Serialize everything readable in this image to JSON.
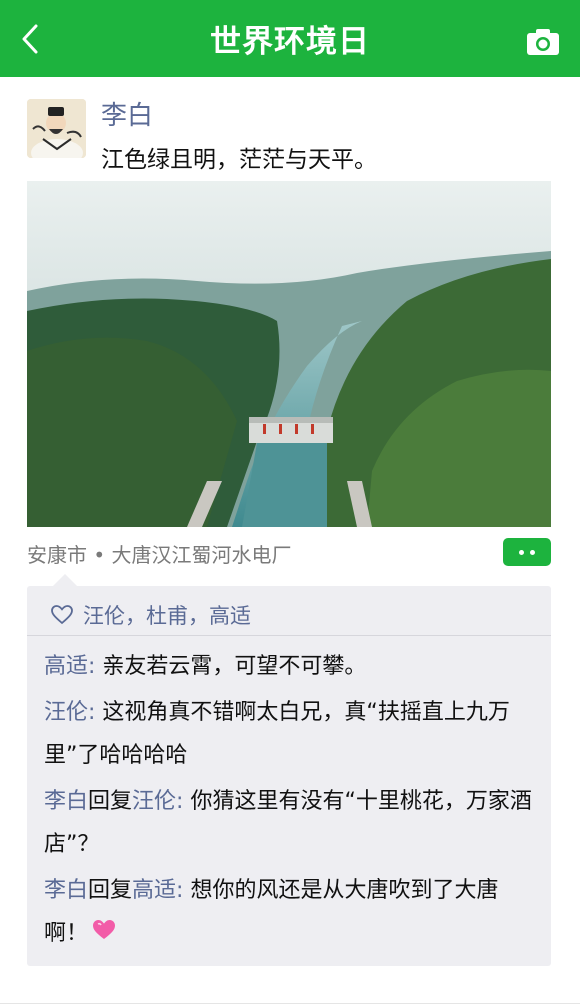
{
  "header": {
    "title": "世界环境日",
    "back_icon": "chevron-left-icon",
    "camera_icon": "camera-icon",
    "background": "#1db33e"
  },
  "post": {
    "author": "李白",
    "content": "江色绿且明，茫茫与天平。",
    "location": "安康市 • 大唐汉江蜀河水电厂"
  },
  "likes": {
    "icon": "heart-outline-icon",
    "names": "汪伦，杜甫，高适"
  },
  "comments": [
    {
      "author": "高适",
      "separator": ": ",
      "text": "亲友若云霄，可望不可攀。"
    },
    {
      "author": "汪伦",
      "separator": ": ",
      "text": "这视角真不错啊太白兄，真“扶摇直上九万里”了哈哈哈哈"
    },
    {
      "author": "李白",
      "reply_word": "回复",
      "reply_to": "汪伦",
      "separator": ": ",
      "text": "你猜这里有没有“十里桃花，万家酒店”？"
    },
    {
      "author": "李白",
      "reply_word": "回复",
      "reply_to": "高适",
      "separator": ": ",
      "text": "想你的风还是从大唐吹到了大唐啊！",
      "emoji": "pink-heart-emoji"
    }
  ],
  "colors": {
    "accent": "#1db33e",
    "name": "#5a6a95",
    "comment_bg": "#eeeef2"
  }
}
